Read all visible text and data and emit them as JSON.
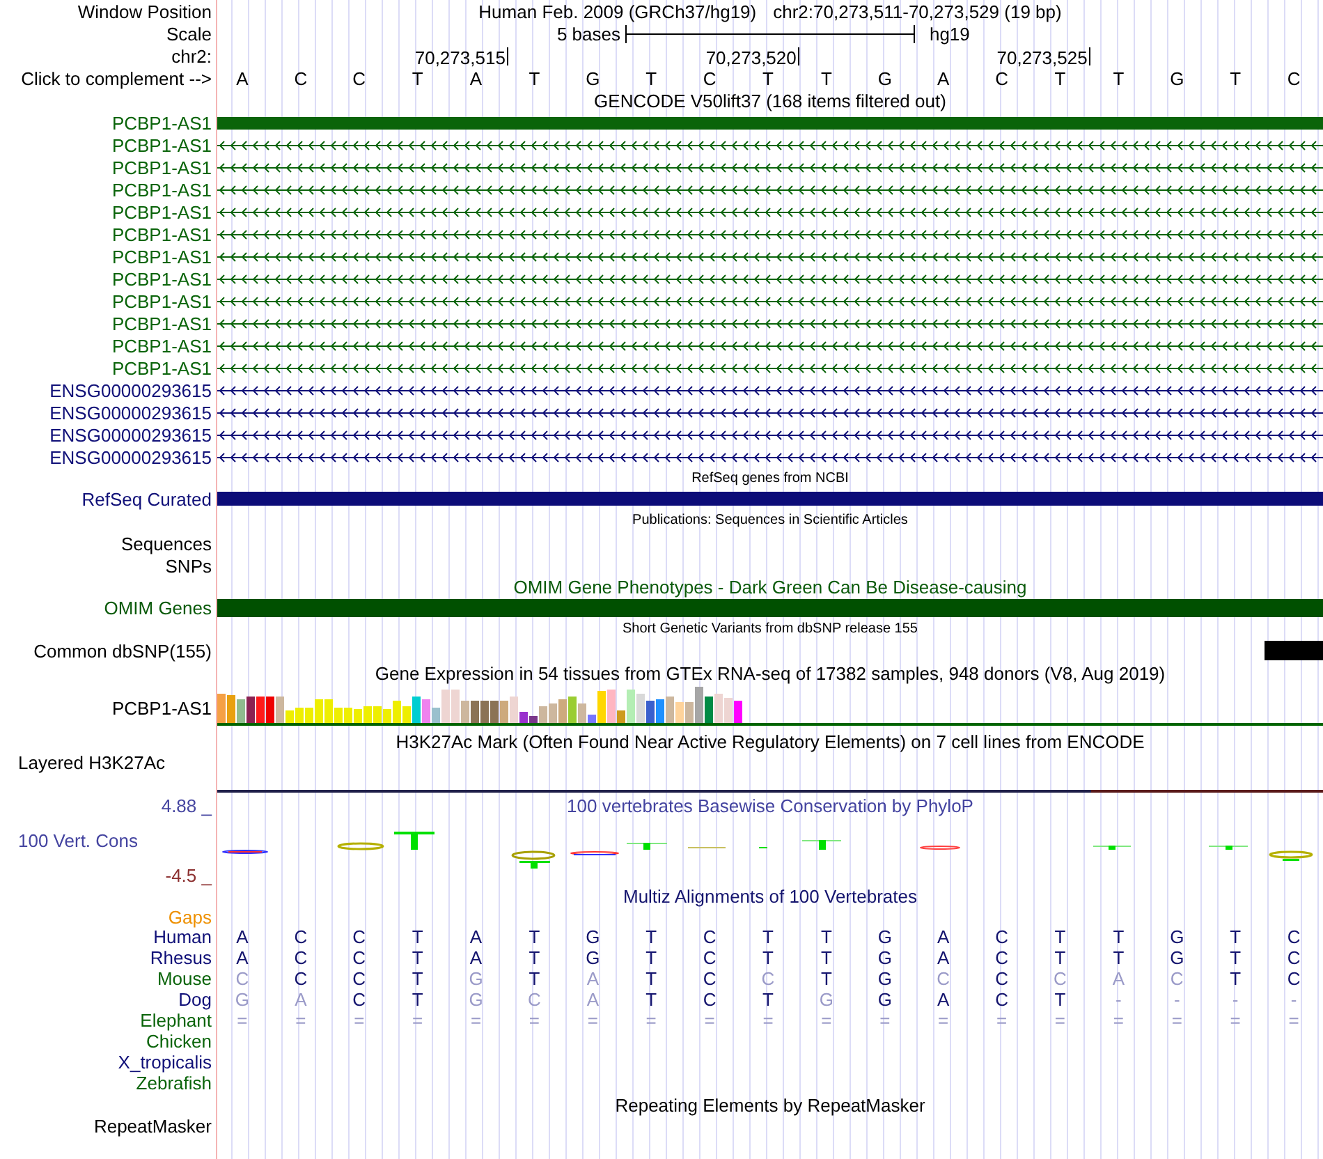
{
  "position_bar": {
    "label": "Window Position",
    "assembly": "Human Feb. 2009 (GRCh37/hg19)",
    "range": "chr2:70,273,511-70,273,529 (19 bp)"
  },
  "scale": {
    "label": "Scale",
    "length": "5 bases",
    "assembly": "hg19"
  },
  "ruler": {
    "label": "chr2:",
    "ticks": [
      "70,273,515",
      "70,273,520",
      "70,273,525"
    ]
  },
  "sequence": {
    "label": "Click to complement -->",
    "bases": [
      "A",
      "C",
      "C",
      "T",
      "A",
      "T",
      "G",
      "T",
      "C",
      "T",
      "T",
      "G",
      "A",
      "C",
      "T",
      "T",
      "G",
      "T",
      "C"
    ]
  },
  "gencode": {
    "title": "GENCODE V50lift37 (168 items filtered out)",
    "items": [
      {
        "name": "PCBP1-AS1",
        "kind": "exon",
        "color": "#0a640a"
      },
      {
        "name": "PCBP1-AS1",
        "kind": "intron",
        "color": "#0a640a"
      },
      {
        "name": "PCBP1-AS1",
        "kind": "intron",
        "color": "#0a640a"
      },
      {
        "name": "PCBP1-AS1",
        "kind": "intron",
        "color": "#0a640a"
      },
      {
        "name": "PCBP1-AS1",
        "kind": "intron",
        "color": "#0a640a"
      },
      {
        "name": "PCBP1-AS1",
        "kind": "intron",
        "color": "#0a640a"
      },
      {
        "name": "PCBP1-AS1",
        "kind": "intron",
        "color": "#0a640a"
      },
      {
        "name": "PCBP1-AS1",
        "kind": "intron",
        "color": "#0a640a"
      },
      {
        "name": "PCBP1-AS1",
        "kind": "intron",
        "color": "#0a640a"
      },
      {
        "name": "PCBP1-AS1",
        "kind": "intron",
        "color": "#0a640a"
      },
      {
        "name": "PCBP1-AS1",
        "kind": "intron",
        "color": "#0a640a"
      },
      {
        "name": "PCBP1-AS1",
        "kind": "intron",
        "color": "#0a640a"
      },
      {
        "name": "ENSG00000293615",
        "kind": "intron",
        "color": "#101078"
      },
      {
        "name": "ENSG00000293615",
        "kind": "intron",
        "color": "#101078"
      },
      {
        "name": "ENSG00000293615",
        "kind": "intron",
        "color": "#101078"
      },
      {
        "name": "ENSG00000293615",
        "kind": "intron",
        "color": "#101078"
      }
    ]
  },
  "refseq": {
    "title": "RefSeq genes from NCBI",
    "label": "RefSeq Curated"
  },
  "publications": {
    "title": "Publications: Sequences in Scientific Articles",
    "subtracks": [
      "Sequences",
      "SNPs"
    ]
  },
  "omim": {
    "title": "OMIM Gene Phenotypes - Dark Green Can Be Disease-causing",
    "label": "OMIM Genes"
  },
  "dbsnp": {
    "title": "Short Genetic Variants from dbSNP release 155",
    "label": "Common dbSNP(155)"
  },
  "gtex": {
    "title": "Gene Expression in 54 tissues from GTEx RNA-seq of 17382 samples, 948 donors (V8, Aug 2019)",
    "label": "PCBP1-AS1"
  },
  "h3k27ac": {
    "title": "H3K27Ac Mark (Often Found Near Active Regulatory Elements) on 7 cell lines from ENCODE",
    "label": "Layered H3K27Ac"
  },
  "phylop": {
    "title": "100 vertebrates Basewise Conservation by PhyloP",
    "label": "100 Vert. Cons",
    "max_label": "4.88 _",
    "min_label": "-4.5 _"
  },
  "multiz": {
    "title": "Multiz Alignments of 100 Vertebrates",
    "gaps_label": "Gaps",
    "species": [
      {
        "name": "Human",
        "color": "#101078",
        "bases": [
          {
            "base": "A",
            "differs": false
          },
          {
            "base": "C",
            "differs": false
          },
          {
            "base": "C",
            "differs": false
          },
          {
            "base": "T",
            "differs": false
          },
          {
            "base": "A",
            "differs": false
          },
          {
            "base": "T",
            "differs": false
          },
          {
            "base": "G",
            "differs": false
          },
          {
            "base": "T",
            "differs": false
          },
          {
            "base": "C",
            "differs": false
          },
          {
            "base": "T",
            "differs": false
          },
          {
            "base": "T",
            "differs": false
          },
          {
            "base": "G",
            "differs": false
          },
          {
            "base": "A",
            "differs": false
          },
          {
            "base": "C",
            "differs": false
          },
          {
            "base": "T",
            "differs": false
          },
          {
            "base": "T",
            "differs": false
          },
          {
            "base": "G",
            "differs": false
          },
          {
            "base": "T",
            "differs": false
          },
          {
            "base": "C",
            "differs": false
          }
        ]
      },
      {
        "name": "Rhesus",
        "color": "#101078",
        "bases": [
          {
            "base": "A",
            "differs": false
          },
          {
            "base": "C",
            "differs": false
          },
          {
            "base": "C",
            "differs": false
          },
          {
            "base": "T",
            "differs": false
          },
          {
            "base": "A",
            "differs": false
          },
          {
            "base": "T",
            "differs": false
          },
          {
            "base": "G",
            "differs": false
          },
          {
            "base": "T",
            "differs": false
          },
          {
            "base": "C",
            "differs": false
          },
          {
            "base": "T",
            "differs": false
          },
          {
            "base": "T",
            "differs": false
          },
          {
            "base": "G",
            "differs": false
          },
          {
            "base": "A",
            "differs": false
          },
          {
            "base": "C",
            "differs": false
          },
          {
            "base": "T",
            "differs": false
          },
          {
            "base": "T",
            "differs": false
          },
          {
            "base": "G",
            "differs": false
          },
          {
            "base": "T",
            "differs": false
          },
          {
            "base": "C",
            "differs": false
          }
        ]
      },
      {
        "name": "Mouse",
        "color": "#0a640a",
        "bases": [
          {
            "base": "C",
            "differs": true
          },
          {
            "base": "C",
            "differs": false
          },
          {
            "base": "C",
            "differs": false
          },
          {
            "base": "T",
            "differs": false
          },
          {
            "base": "G",
            "differs": true
          },
          {
            "base": "T",
            "differs": false
          },
          {
            "base": "A",
            "differs": true
          },
          {
            "base": "T",
            "differs": false
          },
          {
            "base": "C",
            "differs": false
          },
          {
            "base": "C",
            "differs": true
          },
          {
            "base": "T",
            "differs": false
          },
          {
            "base": "G",
            "differs": false
          },
          {
            "base": "C",
            "differs": true
          },
          {
            "base": "C",
            "differs": false
          },
          {
            "base": "C",
            "differs": true
          },
          {
            "base": "A",
            "differs": true
          },
          {
            "base": "C",
            "differs": true
          },
          {
            "base": "T",
            "differs": false
          },
          {
            "base": "C",
            "differs": false
          }
        ]
      },
      {
        "name": "Dog",
        "color": "#101078",
        "bases": [
          {
            "base": "G",
            "differs": true
          },
          {
            "base": "A",
            "differs": true
          },
          {
            "base": "C",
            "differs": false
          },
          {
            "base": "T",
            "differs": false
          },
          {
            "base": "G",
            "differs": true
          },
          {
            "base": "C",
            "differs": true
          },
          {
            "base": "A",
            "differs": true
          },
          {
            "base": "T",
            "differs": false
          },
          {
            "base": "C",
            "differs": false
          },
          {
            "base": "T",
            "differs": false
          },
          {
            "base": "G",
            "differs": true
          },
          {
            "base": "G",
            "differs": false
          },
          {
            "base": "A",
            "differs": false
          },
          {
            "base": "C",
            "differs": false
          },
          {
            "base": "T",
            "differs": false
          },
          {
            "base": "-",
            "differs": true
          },
          {
            "base": "-",
            "differs": true
          },
          {
            "base": "-",
            "differs": true
          },
          {
            "base": "-",
            "differs": true
          }
        ]
      },
      {
        "name": "Elephant",
        "color": "#0a640a",
        "bases": [
          {
            "base": "=",
            "differs": true
          },
          {
            "base": "=",
            "differs": true
          },
          {
            "base": "=",
            "differs": true
          },
          {
            "base": "=",
            "differs": true
          },
          {
            "base": "=",
            "differs": true
          },
          {
            "base": "=",
            "differs": true
          },
          {
            "base": "=",
            "differs": true
          },
          {
            "base": "=",
            "differs": true
          },
          {
            "base": "=",
            "differs": true
          },
          {
            "base": "=",
            "differs": true
          },
          {
            "base": "=",
            "differs": true
          },
          {
            "base": "=",
            "differs": true
          },
          {
            "base": "=",
            "differs": true
          },
          {
            "base": "=",
            "differs": true
          },
          {
            "base": "=",
            "differs": true
          },
          {
            "base": "=",
            "differs": true
          },
          {
            "base": "=",
            "differs": true
          },
          {
            "base": "=",
            "differs": true
          },
          {
            "base": "=",
            "differs": true
          }
        ]
      },
      {
        "name": "Chicken",
        "color": "#0a640a"
      },
      {
        "name": "X_tropicalis",
        "color": "#101078"
      },
      {
        "name": "Zebrafish",
        "color": "#0a640a"
      }
    ]
  },
  "repeatmasker": {
    "title": "Repeating Elements by RepeatMasker",
    "label": "RepeatMasker"
  }
}
